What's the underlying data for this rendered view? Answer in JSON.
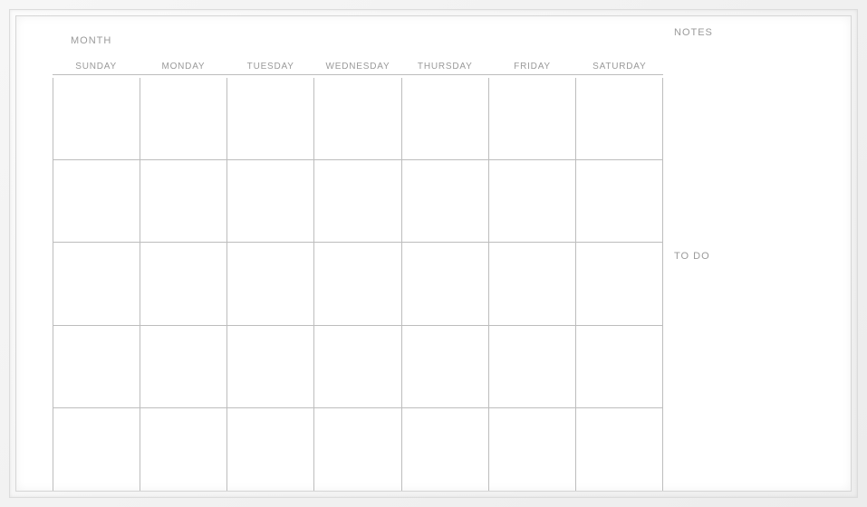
{
  "labels": {
    "month": "MONTH",
    "notes": "NOTES",
    "todo": "TO DO"
  },
  "days": [
    "SUNDAY",
    "MONDAY",
    "TUESDAY",
    "WEDNESDAY",
    "THURSDAY",
    "FRIDAY",
    "SATURDAY"
  ],
  "weeks_count": 5
}
